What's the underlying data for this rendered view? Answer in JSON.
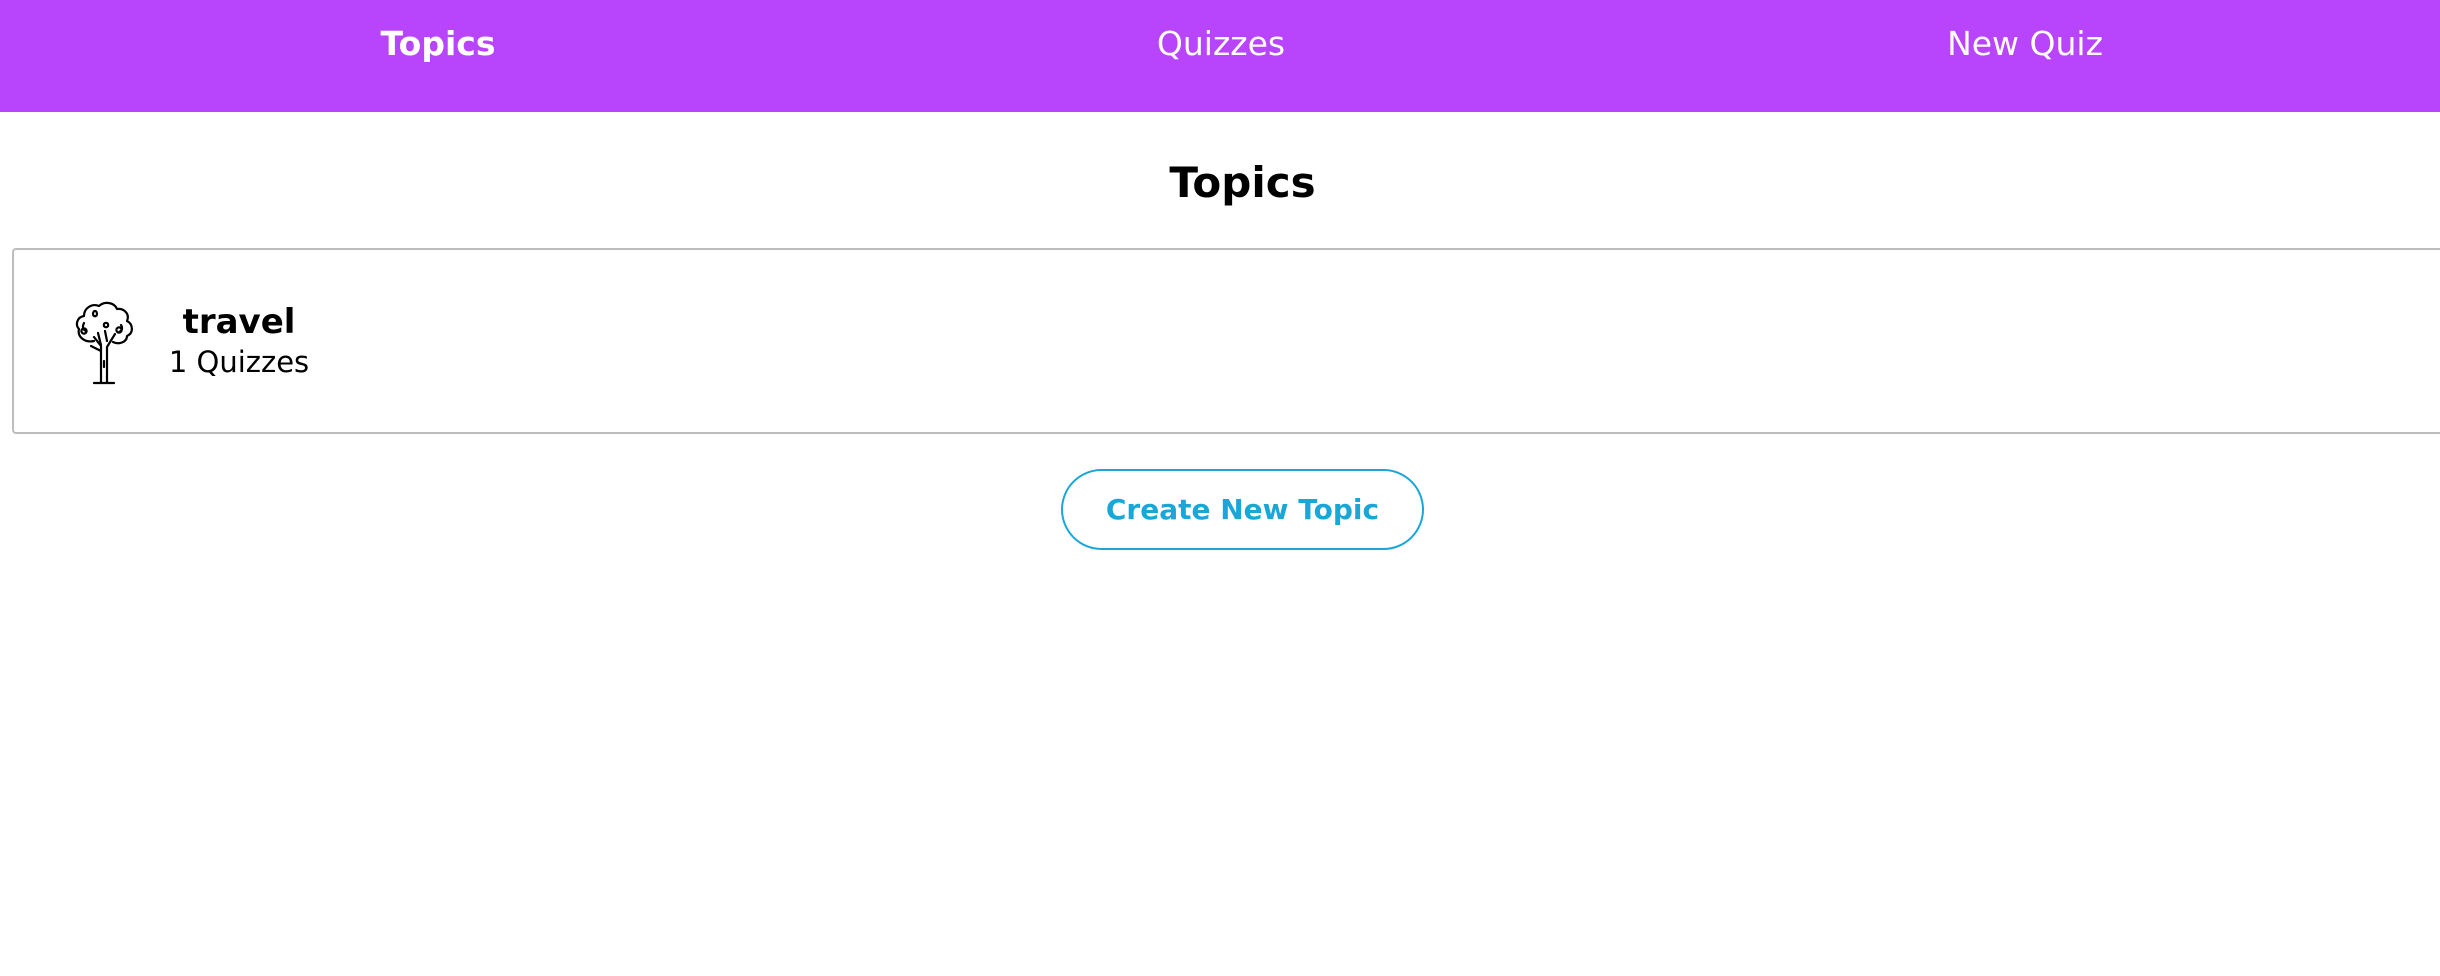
{
  "nav": {
    "links": [
      {
        "label": "Topics",
        "active": true
      },
      {
        "label": "Quizzes",
        "active": false
      },
      {
        "label": "New Quiz",
        "active": false
      }
    ]
  },
  "page": {
    "title": "Topics"
  },
  "topics": [
    {
      "name": "travel",
      "count": "1 Quizzes",
      "icon": "tree-icon"
    }
  ],
  "actions": {
    "create_topic": "Create New Topic"
  },
  "colors": {
    "nav_background": "#b845fc",
    "nav_text": "#ffffff",
    "button_accent": "#1aa7d8",
    "card_border": "#bdbdbd"
  }
}
